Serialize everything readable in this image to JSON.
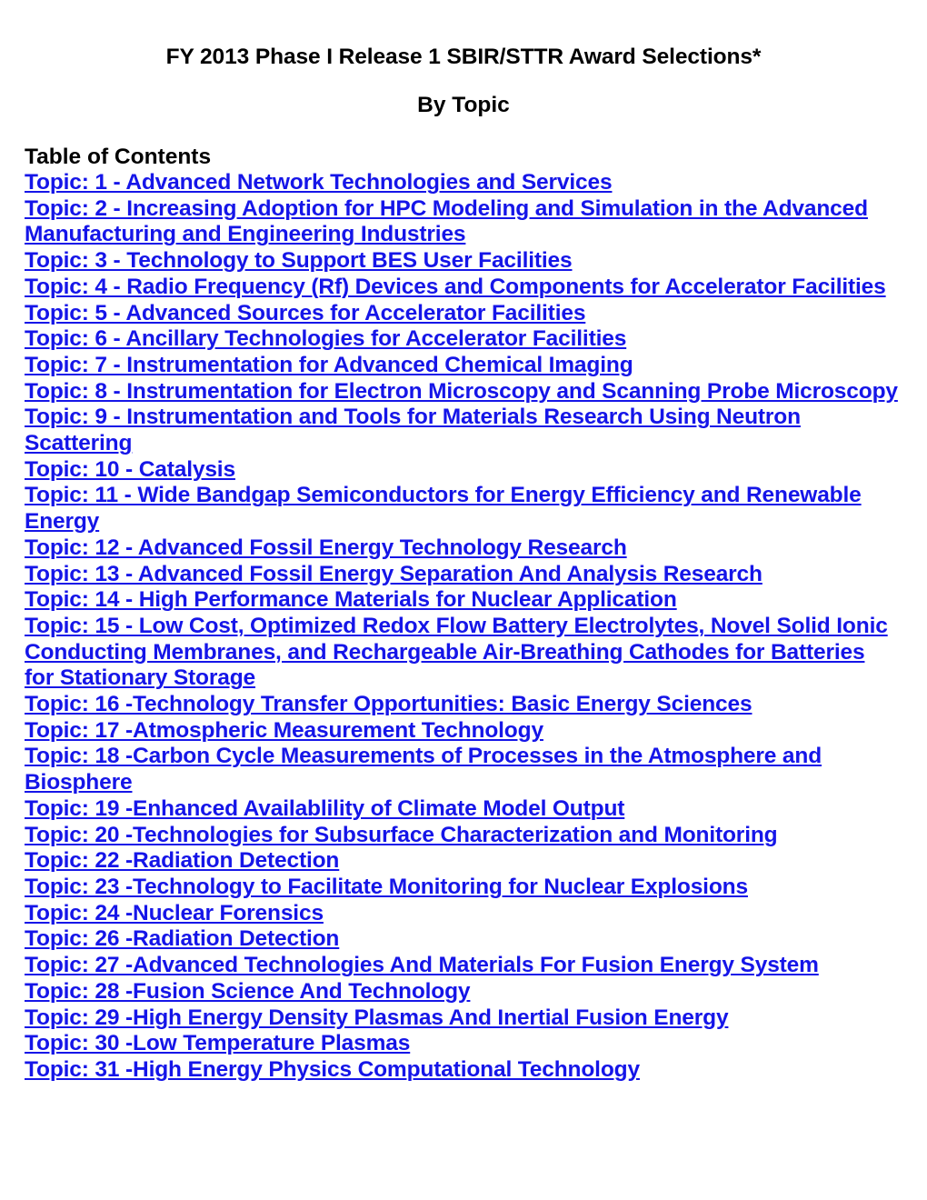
{
  "document": {
    "title": "FY 2013 Phase I Release 1 SBIR/STTR Award Selections*",
    "subtitle": "By Topic",
    "toc_heading": "Table of Contents",
    "link_color": "#1515e8",
    "text_color": "#000000",
    "background_color": "#ffffff"
  },
  "toc": {
    "items": [
      {
        "label": "Topic: 1 - Advanced Network Technologies and Services"
      },
      {
        "label": "Topic: 2 - Increasing Adoption for HPC Modeling and Simulation in the Advanced Manufacturing and Engineering Industries"
      },
      {
        "label": "Topic: 3 - Technology to Support BES User Facilities"
      },
      {
        "label": "Topic: 4 - Radio Frequency (Rf) Devices and Components for Accelerator Facilities"
      },
      {
        "label": "Topic: 5 - Advanced Sources for Accelerator Facilities"
      },
      {
        "label": "Topic: 6 - Ancillary Technologies for Accelerator Facilities"
      },
      {
        "label": "Topic: 7 - Instrumentation for Advanced Chemical Imaging"
      },
      {
        "label": "Topic: 8 - Instrumentation for Electron Microscopy and Scanning Probe Microscopy"
      },
      {
        "label": "Topic: 9 - Instrumentation and Tools for Materials Research Using Neutron Scattering"
      },
      {
        "label": "Topic: 10 - Catalysis"
      },
      {
        "label": "Topic: 11 - Wide Bandgap Semiconductors for Energy Efficiency and Renewable Energy"
      },
      {
        "label": "Topic: 12 - Advanced Fossil Energy Technology Research"
      },
      {
        "label": "Topic: 13 - Advanced Fossil Energy Separation And Analysis Research"
      },
      {
        "label": "Topic: 14 - High Performance Materials for Nuclear Application"
      },
      {
        "label": "Topic: 15 - Low Cost, Optimized Redox Flow Battery Electrolytes, Novel Solid Ionic Conducting Membranes, and Rechargeable Air-Breathing Cathodes for Batteries for Stationary Storage"
      },
      {
        "label": "Topic: 16 -Technology Transfer Opportunities: Basic Energy Sciences"
      },
      {
        "label": "Topic: 17 -Atmospheric Measurement Technology"
      },
      {
        "label": "Topic: 18 -Carbon Cycle Measurements of Processes in the Atmosphere and Biosphere"
      },
      {
        "label": "Topic: 19 -Enhanced Availablility of Climate Model Output"
      },
      {
        "label": "Topic: 20 -Technologies for Subsurface Characterization and Monitoring"
      },
      {
        "label": "Topic: 22 -Radiation Detection"
      },
      {
        "label": "Topic: 23 -Technology to Facilitate Monitoring for Nuclear Explosions"
      },
      {
        "label": "Topic: 24 -Nuclear Forensics"
      },
      {
        "label": "Topic: 26 -Radiation Detection"
      },
      {
        "label": "Topic: 27 -Advanced Technologies And Materials For Fusion Energy System"
      },
      {
        "label": "Topic: 28 -Fusion Science And Technology"
      },
      {
        "label": "Topic: 29 -High Energy Density Plasmas And Inertial Fusion Energy"
      },
      {
        "label": "Topic: 30 -Low Temperature Plasmas"
      },
      {
        "label": "Topic: 31 -High Energy Physics Computational Technology"
      }
    ]
  }
}
